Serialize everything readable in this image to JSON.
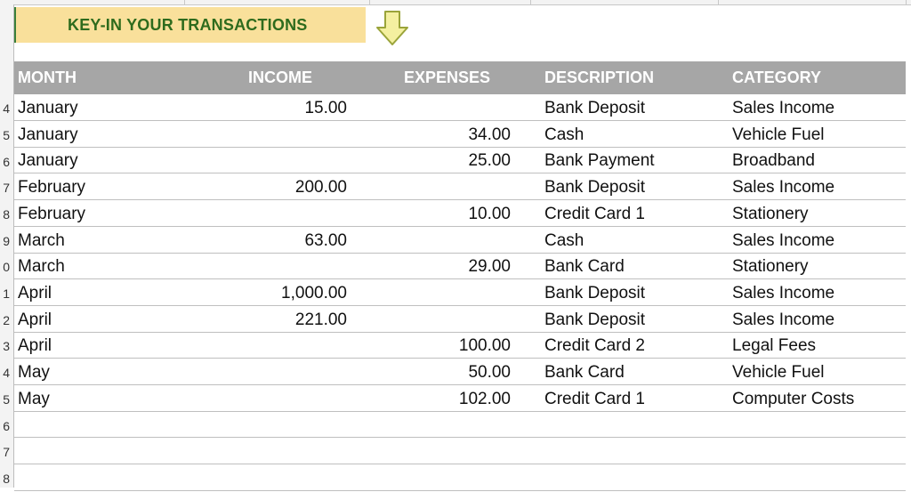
{
  "banner": {
    "title": "KEY-IN YOUR TRANSACTIONS",
    "arrow_icon": "down-arrow-icon"
  },
  "row_numbers": [
    "",
    "",
    "",
    "",
    "4",
    "5",
    "6",
    "7",
    "8",
    "9",
    "0",
    "1",
    "2",
    "3",
    "4",
    "5",
    "6",
    "7",
    "8"
  ],
  "table": {
    "headers": [
      "MONTH",
      "INCOME",
      "EXPENSES",
      "DESCRIPTION",
      "CATEGORY"
    ],
    "rows": [
      {
        "month": "January",
        "income": "15.00",
        "expenses": "",
        "description": "Bank Deposit",
        "category": "Sales Income"
      },
      {
        "month": "January",
        "income": "",
        "expenses": "34.00",
        "description": "Cash",
        "category": "Vehicle Fuel"
      },
      {
        "month": "January",
        "income": "",
        "expenses": "25.00",
        "description": "Bank Payment",
        "category": "Broadband"
      },
      {
        "month": "February",
        "income": "200.00",
        "expenses": "",
        "description": "Bank Deposit",
        "category": "Sales Income"
      },
      {
        "month": "February",
        "income": "",
        "expenses": "10.00",
        "description": "Credit Card 1",
        "category": "Stationery"
      },
      {
        "month": "March",
        "income": "63.00",
        "expenses": "",
        "description": "Cash",
        "category": "Sales Income"
      },
      {
        "month": "March",
        "income": "",
        "expenses": "29.00",
        "description": "Bank Card",
        "category": "Stationery"
      },
      {
        "month": "April",
        "income": "1,000.00",
        "expenses": "",
        "description": "Bank Deposit",
        "category": "Sales Income"
      },
      {
        "month": "April",
        "income": "221.00",
        "expenses": "",
        "description": "Bank Deposit",
        "category": "Sales Income"
      },
      {
        "month": "April",
        "income": "",
        "expenses": "100.00",
        "description": "Credit Card 2",
        "category": "Legal Fees"
      },
      {
        "month": "May",
        "income": "",
        "expenses": "50.00",
        "description": "Bank Card",
        "category": "Vehicle Fuel"
      },
      {
        "month": "May",
        "income": "",
        "expenses": "102.00",
        "description": "Credit Card 1",
        "category": "Computer Costs"
      },
      {
        "month": "",
        "income": "",
        "expenses": "",
        "description": "",
        "category": ""
      },
      {
        "month": "",
        "income": "",
        "expenses": "",
        "description": "",
        "category": ""
      },
      {
        "month": "",
        "income": "",
        "expenses": "",
        "description": "",
        "category": ""
      }
    ]
  },
  "colors": {
    "banner_bg": "#f9e09b",
    "banner_text": "#2e6b1d",
    "header_bg": "#a6a6a6",
    "arrow_fill": "#f4f0a0",
    "arrow_stroke": "#9aa43a"
  }
}
